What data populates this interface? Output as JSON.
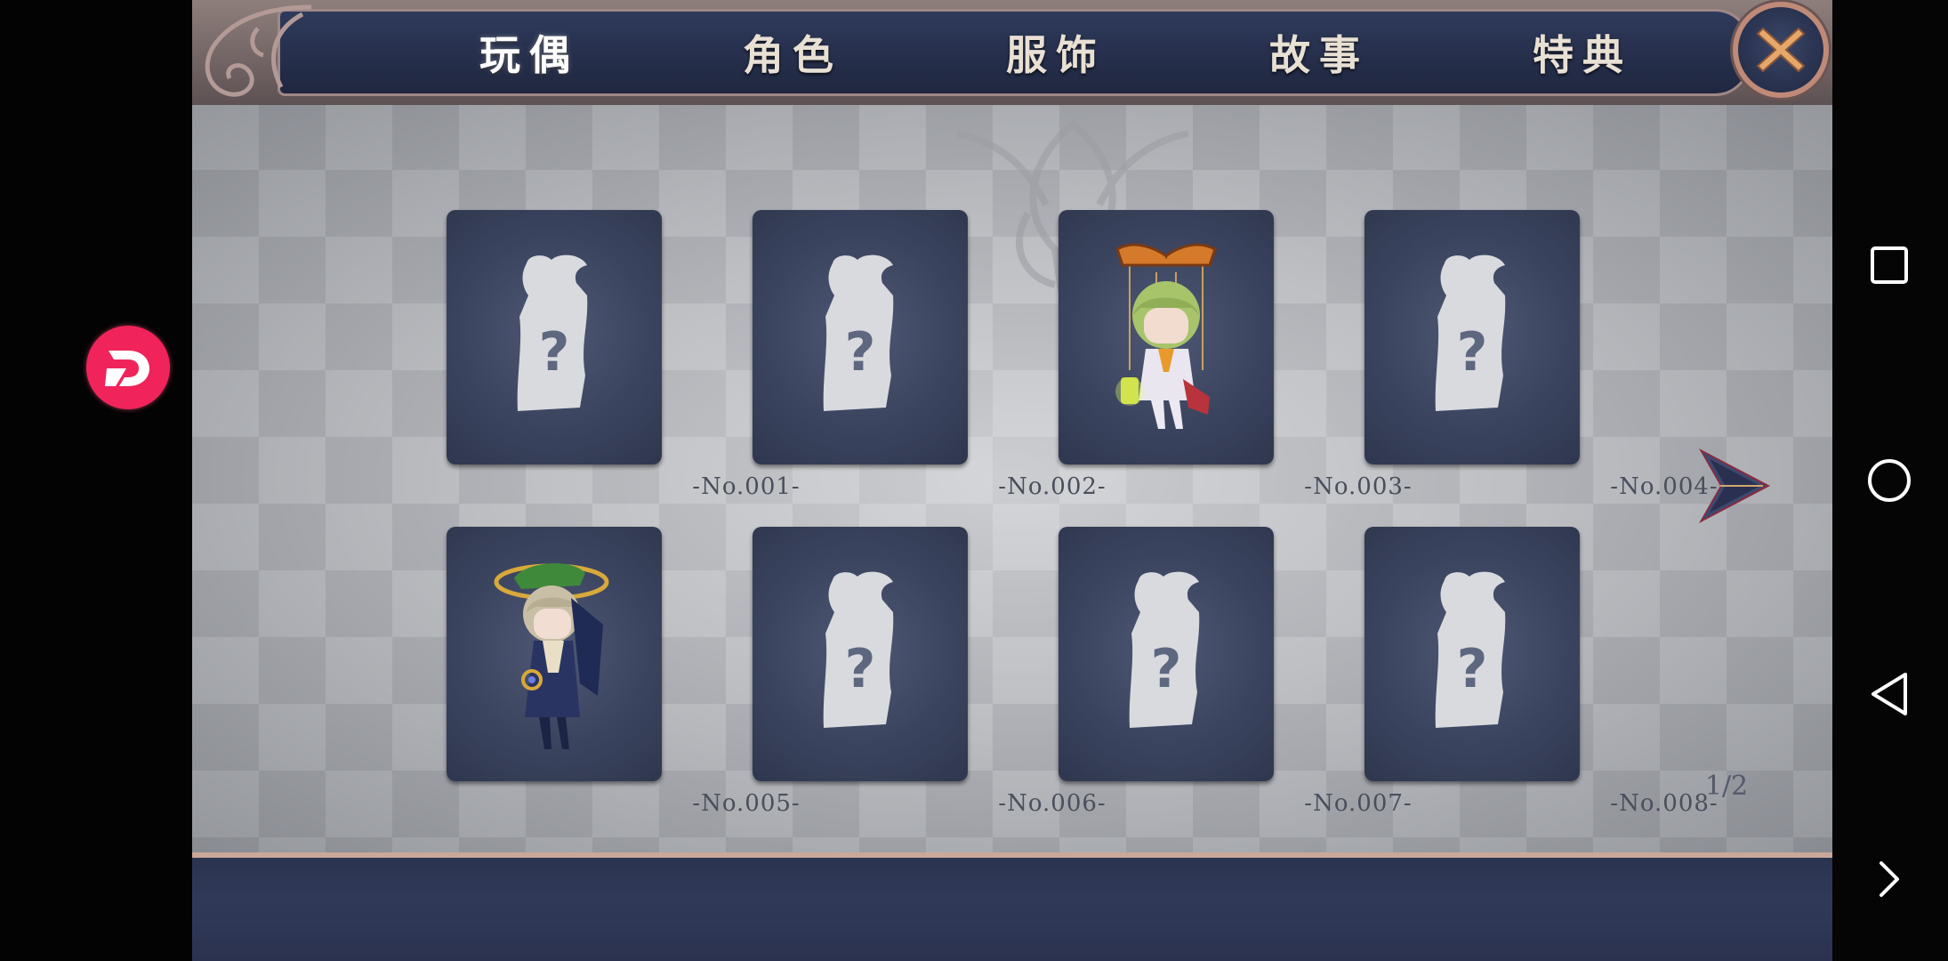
{
  "tabs": [
    {
      "label": "玩偶",
      "active": true
    },
    {
      "label": "角色",
      "active": false
    },
    {
      "label": "服饰",
      "active": false
    },
    {
      "label": "故事",
      "active": false
    },
    {
      "label": "特典",
      "active": false
    }
  ],
  "cards": [
    {
      "label": "-No.001-",
      "unlocked": false
    },
    {
      "label": "-No.002-",
      "unlocked": false
    },
    {
      "label": "-No.003-",
      "unlocked": true
    },
    {
      "label": "-No.004-",
      "unlocked": false
    },
    {
      "label": "-No.005-",
      "unlocked": true
    },
    {
      "label": "-No.006-",
      "unlocked": false
    },
    {
      "label": "-No.007-",
      "unlocked": false
    },
    {
      "label": "-No.008-",
      "unlocked": false
    }
  ],
  "pagination": {
    "text": "1/2",
    "current": 1,
    "total": 2
  },
  "icons": {
    "close": "close-icon",
    "next": "next-arrow-icon",
    "locked": "locked-silhouette-icon",
    "overlay": "floating-app-icon",
    "nav": [
      "recent-apps-icon",
      "home-icon",
      "back-icon",
      "expand-icon"
    ]
  },
  "colors": {
    "accent": "#f0245a",
    "tabbar": "#2a3350",
    "card": "#3b445f",
    "frame": "#c08a78"
  }
}
